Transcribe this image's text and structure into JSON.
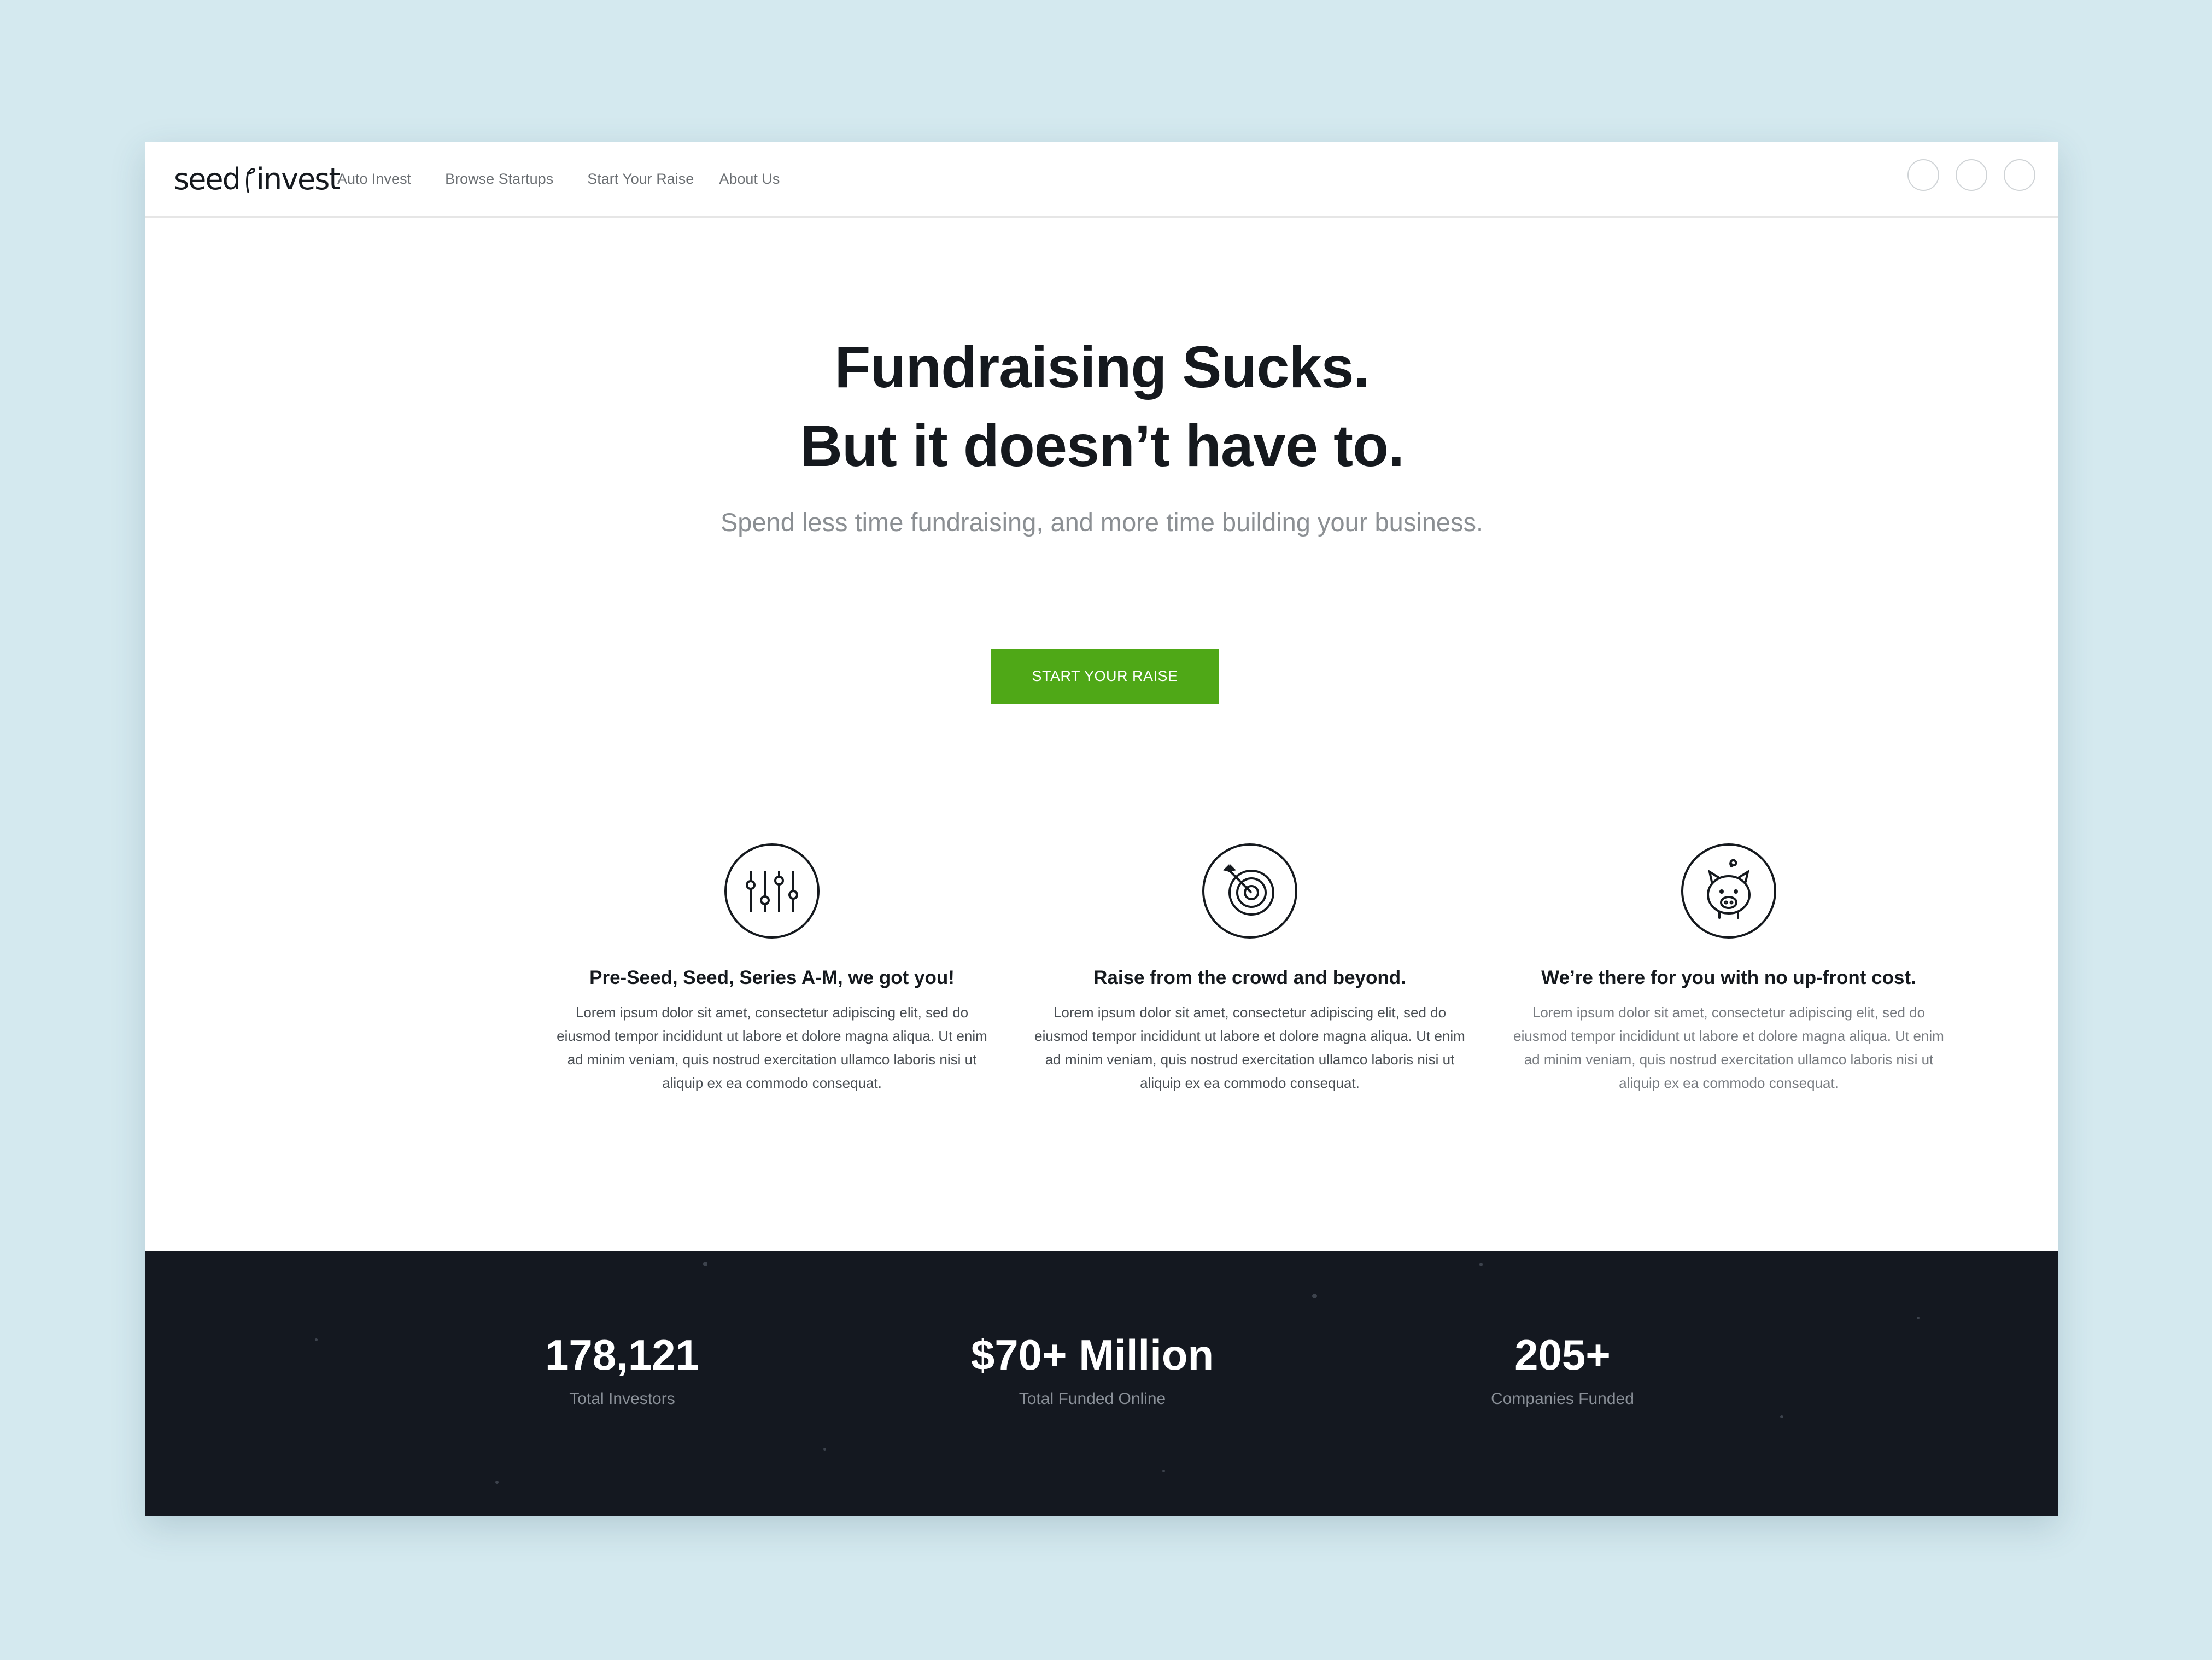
{
  "brand": {
    "logo_text_left": "seed",
    "logo_text_right": "invest",
    "accent": "#4fa817",
    "dark": "#141820"
  },
  "nav": {
    "links": [
      "Auto Invest",
      "Browse Startups",
      "Start Your Raise",
      "About Us"
    ],
    "right_buttons": [
      "circle-button",
      "circle-button",
      "circle-button"
    ]
  },
  "hero": {
    "headline_line1": "Fundraising Sucks.",
    "headline_line2": "But it doesn’t have to.",
    "subhead": "Spend less time fundraising, and more time building your business.",
    "cta_label": "START YOUR RAISE"
  },
  "features": [
    {
      "icon": "sliders-icon",
      "title": "Pre-Seed, Seed, Series A-M, we got you!",
      "body": "Lorem ipsum dolor sit amet, consectetur adipiscing elit, sed do eiusmod tempor incididunt ut labore et dolore magna aliqua. Ut enim ad minim veniam, quis nostrud exercitation ullamco laboris nisi ut aliquip ex ea commodo consequat."
    },
    {
      "icon": "target-icon",
      "title": "Raise from the crowd and beyond.",
      "body": "Lorem ipsum dolor sit amet, consectetur adipiscing elit, sed do eiusmod tempor incididunt ut labore et dolore magna aliqua. Ut enim ad minim veniam, quis nostrud exercitation ullamco laboris nisi ut aliquip ex ea commodo consequat."
    },
    {
      "icon": "piggy-bank-icon",
      "title": "We’re there for you with no up-front cost.",
      "body": "Lorem ipsum dolor sit amet, consectetur adipiscing elit, sed do eiusmod tempor incididunt ut labore et dolore magna aliqua. Ut enim ad minim veniam, quis nostrud exercitation ullamco laboris nisi ut aliquip ex ea commodo consequat."
    }
  ],
  "stats": [
    {
      "value": "178,121",
      "label": "Total Investors"
    },
    {
      "value": "$70+ Million",
      "label": "Total Funded Online"
    },
    {
      "value": "205+",
      "label": "Companies Funded"
    }
  ]
}
